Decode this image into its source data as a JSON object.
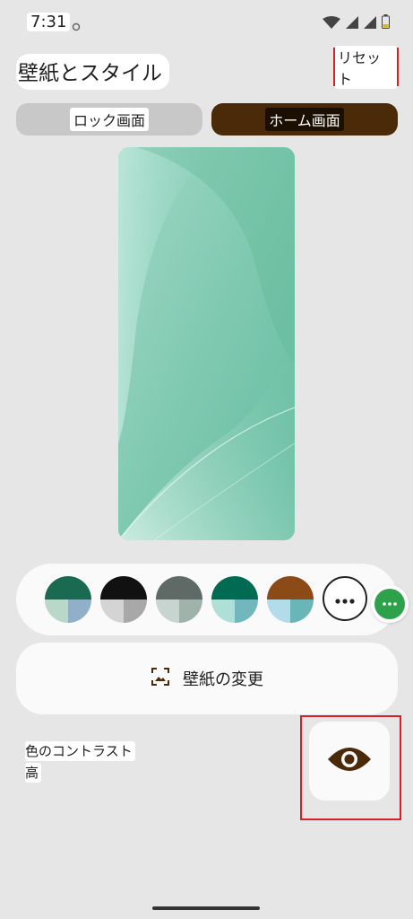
{
  "status_bar": {
    "time": "7:31",
    "icons": [
      "sync-icon",
      "wifi-icon",
      "signal-icon",
      "signal-icon",
      "battery-icon"
    ]
  },
  "header": {
    "title": "壁紙とスタイル",
    "reset_label": "リセット"
  },
  "tabs": [
    {
      "label": "ロック画面",
      "selected": false
    },
    {
      "label": "ホーム画面",
      "selected": true
    }
  ],
  "colors": {
    "background": "#e6e6e6",
    "tab_selected": "#4a2a08",
    "highlight_border": "#d5202a",
    "accent_green": "#2ea24a",
    "eye_icon": "#4a2a08"
  },
  "palette": {
    "swatches": [
      {
        "top": "#1a6a52",
        "bottom_left": "#b9d8ca",
        "bottom_right": "#8fb0c8"
      },
      {
        "top": "#111111",
        "bottom_left": "#d4d4d4",
        "bottom_right": "#a8a8a8"
      },
      {
        "top": "#5f6a66",
        "bottom_left": "#c8d4cf",
        "bottom_right": "#9fb3aa"
      },
      {
        "top": "#006b52",
        "bottom_left": "#aee0d7",
        "bottom_right": "#72b6be"
      },
      {
        "top": "#8b4a16",
        "bottom_left": "#b2dcea",
        "bottom_right": "#6ab5b8"
      }
    ],
    "more_icon": "more-horiz-icon"
  },
  "change_wallpaper": {
    "label": "壁紙の変更",
    "icon": "wallpaper-icon"
  },
  "contrast": {
    "title": "色のコントラスト",
    "value": "高",
    "icon": "eye-icon"
  }
}
